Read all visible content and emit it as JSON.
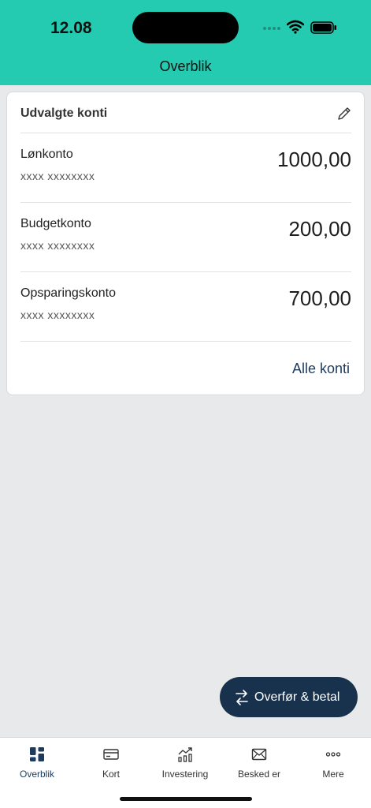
{
  "status_bar": {
    "time": "12.08"
  },
  "header": {
    "title": "Overblik"
  },
  "card": {
    "title": "Udvalgte konti",
    "accounts": [
      {
        "name": "Lønkonto",
        "number": "xxxx xxxxxxxx",
        "balance": "1000,00"
      },
      {
        "name": "Budgetkonto",
        "number": "xxxx xxxxxxxx",
        "balance": "200,00"
      },
      {
        "name": "Opsparingskonto",
        "number": "xxxx xxxxxxxx",
        "balance": "700,00"
      }
    ],
    "all_link": "Alle konti"
  },
  "fab": {
    "label": "Overfør & betal",
    "icon": "transfer-icon"
  },
  "tabs": [
    {
      "label": "Overblik",
      "icon": "dashboard-icon",
      "active": true
    },
    {
      "label": "Kort",
      "icon": "card-icon",
      "active": false
    },
    {
      "label": "Investering",
      "icon": "chart-icon",
      "active": false
    },
    {
      "label": "Besked er",
      "icon": "mail-icon",
      "active": false
    },
    {
      "label": "Mere",
      "icon": "more-icon",
      "active": false
    }
  ],
  "colors": {
    "header": "#24cbb0",
    "primary": "#18324d",
    "background": "#e8e9eb"
  }
}
